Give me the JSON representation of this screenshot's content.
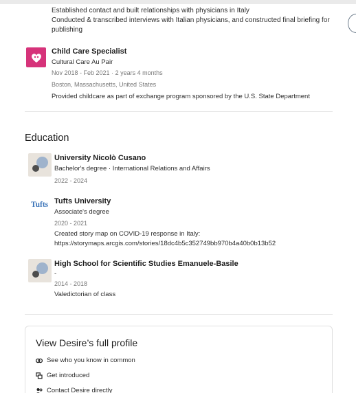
{
  "experience_top": {
    "desc_line1": "Established contact and built relationships with physicians in Italy",
    "desc_line2": "Conducted & transcribed interviews with Italian physicians, and constructed final briefing for",
    "desc_line3": "publishing"
  },
  "experience_childcare": {
    "title": "Child Care Specialist",
    "company": "Cultural Care Au Pair",
    "dates": "Nov 2018 - Feb 2021",
    "duration": "· 2 years 4 months",
    "location": "Boston, Massachusetts, United States",
    "description": "Provided childcare as part of exchange program sponsored by the U.S. State Department",
    "logo_color": "#d6337a"
  },
  "education": {
    "title": "Education",
    "items": [
      {
        "school": "University Nicolò Cusano",
        "degree": "Bachelor's degree",
        "field": "· International Relations and Affairs",
        "dates": "2022 - 2024"
      },
      {
        "school": "Tufts University",
        "logo_text": "Tufts",
        "degree": "Associate's degree",
        "dates": "2020 - 2021",
        "description_line1": "Created story map on COVID-19 response in Italy:",
        "description_line2": "https://storymaps.arcgis.com/stories/18dc4b5c352749bb970b4a40b0b13b52"
      },
      {
        "school": "High School for Scientific Studies Emanuele-Basile",
        "degree": "-",
        "dates": "2014 - 2018",
        "description": "Valedictorian of class"
      }
    ]
  },
  "profile_card": {
    "title": "View Desire’s full profile",
    "items": [
      {
        "label": "See who you know in common",
        "icon": "mutual-connections-icon"
      },
      {
        "label": "Get introduced",
        "icon": "introduction-icon"
      },
      {
        "label": "Contact Desire directly",
        "icon": "contact-person-icon"
      }
    ]
  },
  "colors": {
    "link_blue": "#3a73b8",
    "muted_text": "#777777"
  }
}
